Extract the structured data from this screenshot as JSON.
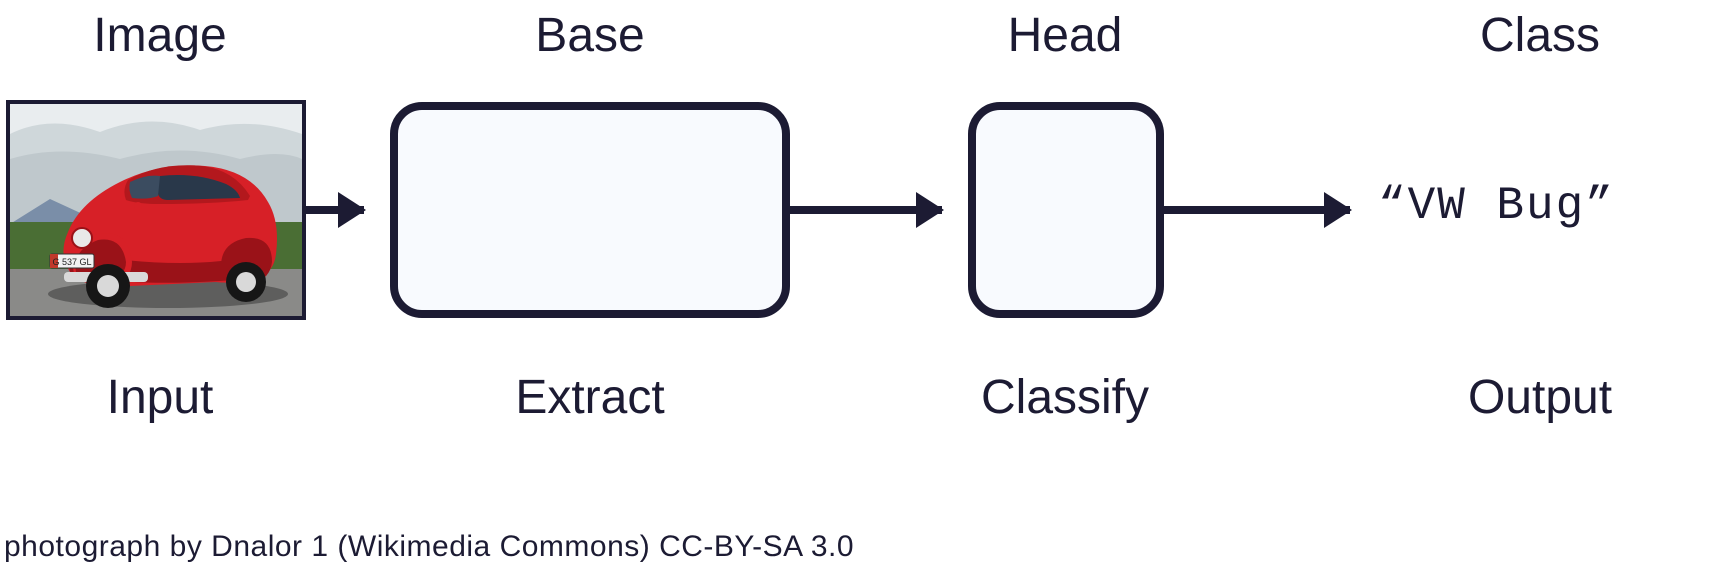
{
  "labels": {
    "image_top": "Image",
    "image_bottom": "Input",
    "base_top": "Base",
    "base_bottom": "Extract",
    "head_top": "Head",
    "head_bottom": "Classify",
    "class_top": "Class",
    "class_bottom": "Output"
  },
  "output_text": "“VW Bug”",
  "credit": "photograph by Dnalor 1 (Wikimedia Commons) CC-BY-SA 3.0",
  "colors": {
    "stroke": "#1c1b33",
    "block_fill": "#f8fafe",
    "car_body": "#d72027",
    "car_dark": "#9a1218",
    "sky": "#cfd7da",
    "grass": "#4a6e34",
    "mountain": "#7a8ea8",
    "road": "#8a8a88",
    "plate_white": "#f2f2f2",
    "plate_red": "#c0392b",
    "tire": "#161616",
    "hub": "#d9d9d9",
    "window": "#29384a"
  }
}
